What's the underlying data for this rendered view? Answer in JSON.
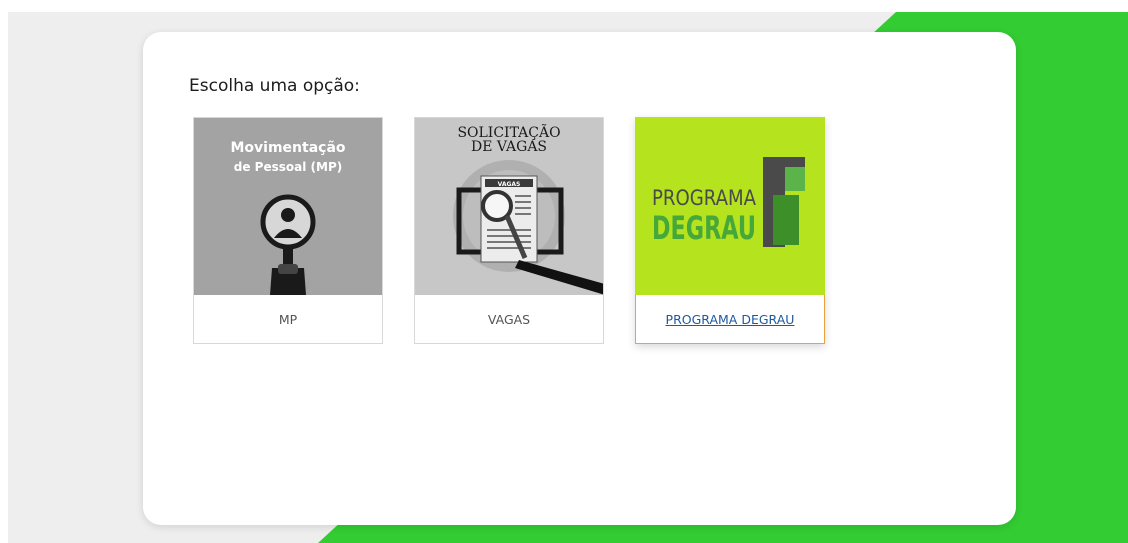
{
  "heading": "Escolha uma opção:",
  "options": [
    {
      "label": "MP",
      "image_text": [
        "Movimentação",
        "de Pessoal (MP)"
      ]
    },
    {
      "label": "VAGAS",
      "image_text": [
        "SOLICITAÇÃO",
        "DE VAGAS",
        "VAGAS"
      ]
    },
    {
      "label": "PROGRAMA DEGRAU",
      "image_text": [
        "PROGRAMA",
        "DEGRAU"
      ]
    }
  ],
  "colors": {
    "accent_green": "#33cc33",
    "degrau_bg": "#b5e31e",
    "link": "#1e5aa0",
    "selected_border": "#e8a33a"
  }
}
